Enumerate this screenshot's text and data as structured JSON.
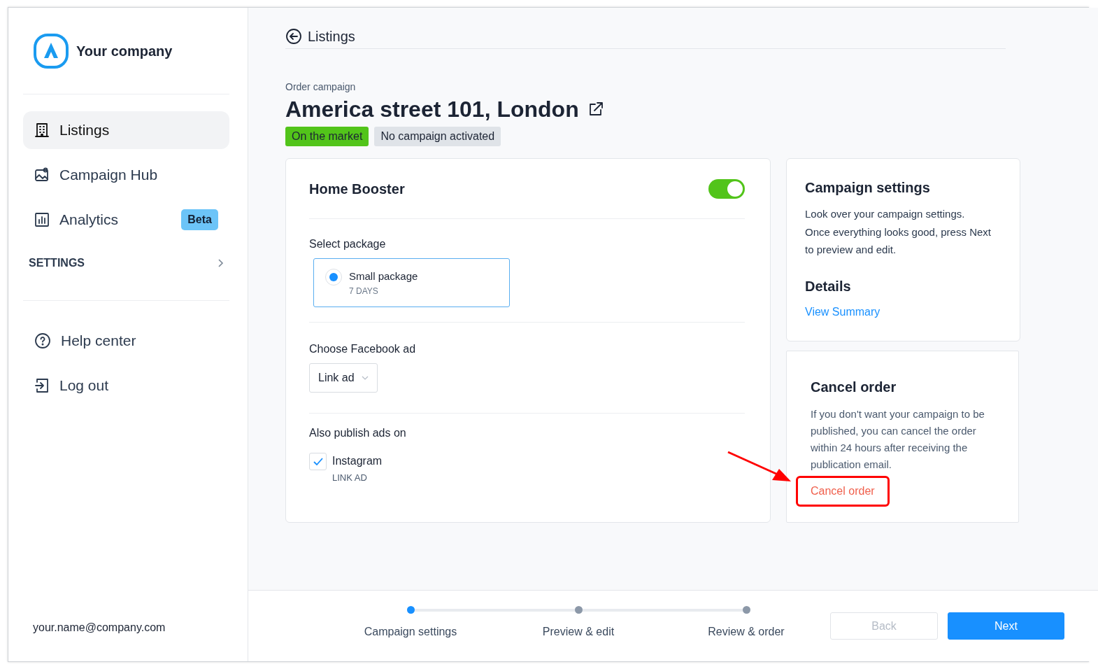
{
  "sidebar": {
    "brand": "Your company",
    "nav": [
      {
        "label": "Listings",
        "selected": true
      },
      {
        "label": "Campaign Hub",
        "selected": false
      },
      {
        "label": "Analytics",
        "selected": false,
        "badge": "Beta"
      }
    ],
    "settings": {
      "label": "SETTINGS",
      "expanded": false
    },
    "links": [
      {
        "label": "Help center"
      },
      {
        "label": "Log out"
      }
    ],
    "email": "your.name@company.com"
  },
  "header": {
    "back_label": "Listings"
  },
  "page": {
    "eyebrow": "Order campaign",
    "title": "America street 101, London",
    "tags": [
      {
        "label": "On the market",
        "color": "#52c41a"
      },
      {
        "label": "No campaign activated",
        "color": "#dfe3e8"
      }
    ]
  },
  "booster": {
    "title": "Home Booster",
    "on": true,
    "package_label": "Select package",
    "packages": [
      {
        "name": "Small package",
        "duration": "7 DAYS",
        "selected": true
      }
    ],
    "ad_label": "Choose Facebook ad",
    "ad_value": "Link ad",
    "publish_label": "Also publish ads on",
    "platforms": [
      {
        "name": "Instagram",
        "sub": "LINK AD",
        "checked": true
      }
    ]
  },
  "settings_card": {
    "title": "Campaign settings",
    "text": "Look over your campaign settings. Once everything looks good, press Next to preview and edit.",
    "details_title": "Details",
    "details_link": "View Summary"
  },
  "cancel_card": {
    "title": "Cancel order",
    "text": "If you don't want your campaign to be published, you can cancel the order within 24 hours after receiving the publication email.",
    "link": "Cancel order",
    "highlighted": true
  },
  "steps": [
    {
      "label": "Campaign settings",
      "selected": true
    },
    {
      "label": "Preview & edit",
      "selected": false
    },
    {
      "label": "Review & order",
      "selected": false
    }
  ],
  "buttons": [
    {
      "label": "Back",
      "kind": "secondary",
      "disabled": true
    },
    {
      "label": "Next",
      "kind": "primary",
      "disabled": false
    }
  ]
}
